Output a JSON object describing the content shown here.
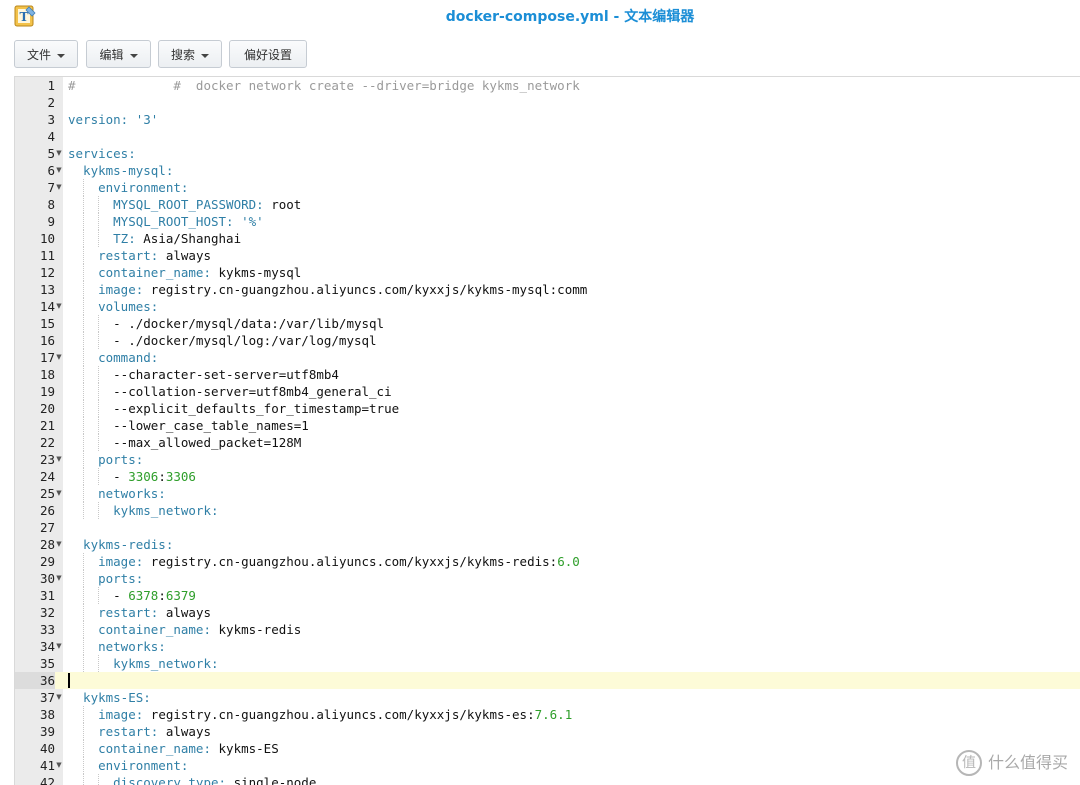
{
  "window": {
    "filename": "docker-compose.yml",
    "separator": " - ",
    "app_name": "文本编辑器"
  },
  "toolbar": {
    "file_label": "文件",
    "edit_label": "编辑",
    "search_label": "搜索",
    "prefs_label": "偏好设置"
  },
  "editor": {
    "active_line": 36,
    "lines": [
      {
        "n": "1",
        "fold": false,
        "tokens": [
          {
            "t": "#             #  docker network create --driver=bridge kykms_network",
            "c": "com"
          }
        ]
      },
      {
        "n": "2",
        "fold": false,
        "tokens": []
      },
      {
        "n": "3",
        "fold": false,
        "tokens": [
          {
            "t": "version: ",
            "c": "key"
          },
          {
            "t": "'3'",
            "c": "str"
          }
        ]
      },
      {
        "n": "4",
        "fold": false,
        "tokens": []
      },
      {
        "n": "5",
        "fold": true,
        "tokens": [
          {
            "t": "services:",
            "c": "key"
          }
        ]
      },
      {
        "n": "6",
        "fold": true,
        "tokens": [
          {
            "t": "  kykms-mysql:",
            "c": "key"
          }
        ]
      },
      {
        "n": "7",
        "fold": true,
        "tokens": [
          {
            "t": "    environment:",
            "c": "key"
          }
        ]
      },
      {
        "n": "8",
        "fold": false,
        "tokens": [
          {
            "t": "      MYSQL_ROOT_PASSWORD: ",
            "c": "key"
          },
          {
            "t": "root",
            "c": "val"
          }
        ]
      },
      {
        "n": "9",
        "fold": false,
        "tokens": [
          {
            "t": "      MYSQL_ROOT_HOST: ",
            "c": "key"
          },
          {
            "t": "'%'",
            "c": "str"
          }
        ]
      },
      {
        "n": "10",
        "fold": false,
        "tokens": [
          {
            "t": "      TZ: ",
            "c": "key"
          },
          {
            "t": "Asia/Shanghai",
            "c": "val"
          }
        ]
      },
      {
        "n": "11",
        "fold": false,
        "tokens": [
          {
            "t": "    restart: ",
            "c": "key"
          },
          {
            "t": "always",
            "c": "val"
          }
        ]
      },
      {
        "n": "12",
        "fold": false,
        "tokens": [
          {
            "t": "    container_name: ",
            "c": "key"
          },
          {
            "t": "kykms-mysql",
            "c": "val"
          }
        ]
      },
      {
        "n": "13",
        "fold": false,
        "tokens": [
          {
            "t": "    image: ",
            "c": "key"
          },
          {
            "t": "registry.cn-guangzhou.aliyuncs.com/kyxxjs/kykms-mysql:comm",
            "c": "val"
          }
        ]
      },
      {
        "n": "14",
        "fold": true,
        "tokens": [
          {
            "t": "    volumes:",
            "c": "key"
          }
        ]
      },
      {
        "n": "15",
        "fold": false,
        "tokens": [
          {
            "t": "      - ./docker/mysql/data:/var/lib/mysql",
            "c": "val"
          }
        ]
      },
      {
        "n": "16",
        "fold": false,
        "tokens": [
          {
            "t": "      - ./docker/mysql/log:/var/log/mysql",
            "c": "val"
          }
        ]
      },
      {
        "n": "17",
        "fold": true,
        "tokens": [
          {
            "t": "    command:",
            "c": "key"
          }
        ]
      },
      {
        "n": "18",
        "fold": false,
        "tokens": [
          {
            "t": "      --character-set-server=utf8mb4",
            "c": "val"
          }
        ]
      },
      {
        "n": "19",
        "fold": false,
        "tokens": [
          {
            "t": "      --collation-server=utf8mb4_general_ci",
            "c": "val"
          }
        ]
      },
      {
        "n": "20",
        "fold": false,
        "tokens": [
          {
            "t": "      --explicit_defaults_for_timestamp=true",
            "c": "val"
          }
        ]
      },
      {
        "n": "21",
        "fold": false,
        "tokens": [
          {
            "t": "      --lower_case_table_names=1",
            "c": "val"
          }
        ]
      },
      {
        "n": "22",
        "fold": false,
        "tokens": [
          {
            "t": "      --max_allowed_packet=128M",
            "c": "val"
          }
        ]
      },
      {
        "n": "23",
        "fold": true,
        "tokens": [
          {
            "t": "    ports:",
            "c": "key"
          }
        ]
      },
      {
        "n": "24",
        "fold": false,
        "tokens": [
          {
            "t": "      - ",
            "c": "val"
          },
          {
            "t": "3306",
            "c": "num"
          },
          {
            "t": ":",
            "c": "val"
          },
          {
            "t": "3306",
            "c": "num"
          }
        ]
      },
      {
        "n": "25",
        "fold": true,
        "tokens": [
          {
            "t": "    networks:",
            "c": "key"
          }
        ]
      },
      {
        "n": "26",
        "fold": false,
        "tokens": [
          {
            "t": "      kykms_network:",
            "c": "key"
          }
        ]
      },
      {
        "n": "27",
        "fold": false,
        "tokens": []
      },
      {
        "n": "28",
        "fold": true,
        "tokens": [
          {
            "t": "  kykms-redis:",
            "c": "key"
          }
        ]
      },
      {
        "n": "29",
        "fold": false,
        "tokens": [
          {
            "t": "    image: ",
            "c": "key"
          },
          {
            "t": "registry.cn-guangzhou.aliyuncs.com/kyxxjs/kykms-redis:",
            "c": "val"
          },
          {
            "t": "6.0",
            "c": "num"
          }
        ]
      },
      {
        "n": "30",
        "fold": true,
        "tokens": [
          {
            "t": "    ports:",
            "c": "key"
          }
        ]
      },
      {
        "n": "31",
        "fold": false,
        "tokens": [
          {
            "t": "      - ",
            "c": "val"
          },
          {
            "t": "6378",
            "c": "num"
          },
          {
            "t": ":",
            "c": "val"
          },
          {
            "t": "6379",
            "c": "num"
          }
        ]
      },
      {
        "n": "32",
        "fold": false,
        "tokens": [
          {
            "t": "    restart: ",
            "c": "key"
          },
          {
            "t": "always",
            "c": "val"
          }
        ]
      },
      {
        "n": "33",
        "fold": false,
        "tokens": [
          {
            "t": "    container_name: ",
            "c": "key"
          },
          {
            "t": "kykms-redis",
            "c": "val"
          }
        ]
      },
      {
        "n": "34",
        "fold": true,
        "tokens": [
          {
            "t": "    networks:",
            "c": "key"
          }
        ]
      },
      {
        "n": "35",
        "fold": false,
        "tokens": [
          {
            "t": "      kykms_network:",
            "c": "key"
          }
        ]
      },
      {
        "n": "36",
        "fold": false,
        "tokens": []
      },
      {
        "n": "37",
        "fold": true,
        "tokens": [
          {
            "t": "  kykms-ES:",
            "c": "key"
          }
        ]
      },
      {
        "n": "38",
        "fold": false,
        "tokens": [
          {
            "t": "    image: ",
            "c": "key"
          },
          {
            "t": "registry.cn-guangzhou.aliyuncs.com/kyxxjs/kykms-es:",
            "c": "val"
          },
          {
            "t": "7.6.1",
            "c": "num"
          }
        ]
      },
      {
        "n": "39",
        "fold": false,
        "tokens": [
          {
            "t": "    restart: ",
            "c": "key"
          },
          {
            "t": "always",
            "c": "val"
          }
        ]
      },
      {
        "n": "40",
        "fold": false,
        "tokens": [
          {
            "t": "    container_name: ",
            "c": "key"
          },
          {
            "t": "kykms-ES",
            "c": "val"
          }
        ]
      },
      {
        "n": "41",
        "fold": true,
        "tokens": [
          {
            "t": "    environment:",
            "c": "key"
          }
        ]
      },
      {
        "n": "42",
        "fold": false,
        "tokens": [
          {
            "t": "      discovery.type: ",
            "c": "key"
          },
          {
            "t": "single-node",
            "c": "val"
          }
        ]
      }
    ]
  },
  "watermark": {
    "icon_glyph": "值",
    "text": "什么值得买"
  }
}
